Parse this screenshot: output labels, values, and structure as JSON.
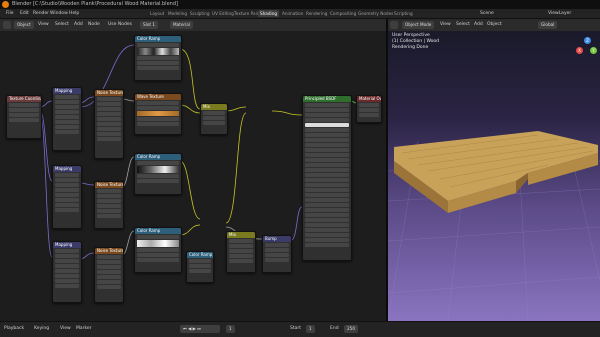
{
  "titlebar": {
    "title": "Blender [C:\\Studio\\Wooden Plank\\Procedural Wood Material.blend]"
  },
  "menubar": {
    "menus": [
      "File",
      "Edit",
      "Render",
      "Window",
      "Help"
    ],
    "workspace_tabs": [
      "Layout",
      "Modeling",
      "Sculpting",
      "UV Editing",
      "Texture Paint",
      "Shading",
      "Animation",
      "Rendering",
      "Compositing",
      "Geometry Nodes",
      "Scripting"
    ],
    "active_tab": "Shading",
    "scene": "Scene",
    "view_layer": "ViewLayer"
  },
  "node_editor": {
    "header": {
      "editor_menu": "Object",
      "items": [
        "View",
        "Select",
        "Add",
        "Node"
      ],
      "use_nodes": "Use Nodes",
      "slot": "Slot 1",
      "material": "Material"
    },
    "nodes": [
      {
        "title": "Texture Coordinate",
        "color": "#6a3b3b"
      },
      {
        "title": "Mapping",
        "color": "#3b3b6a"
      },
      {
        "title": "Noise Texture",
        "color": "#7a4a1e"
      },
      {
        "title": "Color Ramp",
        "color": "#2d5e7a"
      },
      {
        "title": "Wave Texture",
        "color": "#7a4a1e"
      },
      {
        "title": "Color Ramp",
        "color": "#2d5e7a"
      },
      {
        "title": "Mix",
        "color": "#7a7a1e"
      },
      {
        "title": "Mapping",
        "color": "#3b3b6a"
      },
      {
        "title": "Noise Texture",
        "color": "#7a4a1e"
      },
      {
        "title": "Color Ramp",
        "color": "#2d5e7a"
      },
      {
        "title": "Mapping",
        "color": "#3b3b6a"
      },
      {
        "title": "Noise Texture",
        "color": "#7a4a1e"
      },
      {
        "title": "Color Ramp",
        "color": "#2d5e7a"
      },
      {
        "title": "Mix",
        "color": "#7a7a1e"
      },
      {
        "title": "Bump",
        "color": "#3b3b6a"
      },
      {
        "title": "Principled BSDF",
        "color": "#2d6e2d"
      },
      {
        "title": "Material Output",
        "color": "#6a2a2a"
      }
    ]
  },
  "viewport": {
    "header": {
      "mode": "Object Mode",
      "items": [
        "View",
        "Select",
        "Add",
        "Object"
      ],
      "global": "Global"
    },
    "overlay_text": [
      "User Perspective",
      "(1) Collection | Wood",
      "Rendering Done"
    ],
    "gizmo": {
      "x_color": "#e84a4a",
      "y_color": "#7ac943",
      "z_color": "#3f8fe8"
    }
  },
  "statusbar": {
    "items": [
      "Playback",
      "Keying",
      "View",
      "Marker"
    ],
    "frame_current": "1",
    "start_label": "Start",
    "start": "1",
    "end_label": "End",
    "end": "250"
  }
}
